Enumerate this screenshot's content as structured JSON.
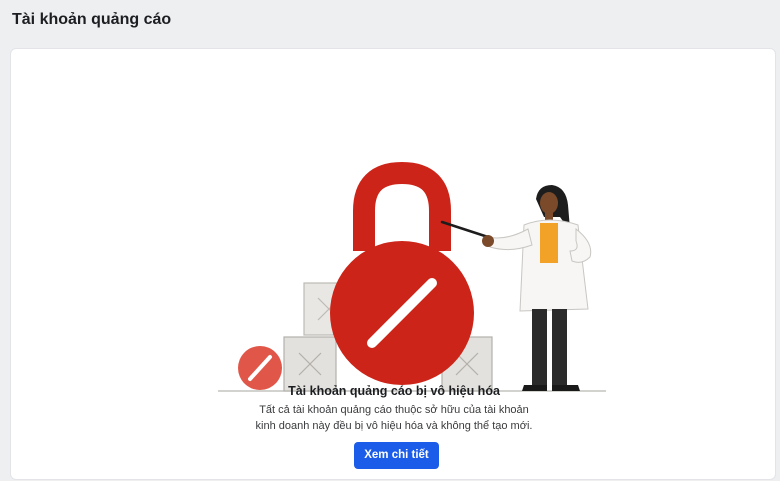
{
  "header": {
    "title": "Tài khoản quảng cáo"
  },
  "notice": {
    "title": "Tài khoản quảng cáo bị vô hiệu hóa",
    "line1": "Tất cả tài khoản quảng cáo thuộc sở hữu của tài khoản",
    "line2": "kinh doanh này đều bị vô hiệu hóa và không thể tạo mới.",
    "button_label": "Xem chi tiết"
  },
  "colors": {
    "accent": "#1b5ce8",
    "lock_red": "#cc2418",
    "badge_red": "#e0574a"
  },
  "icons": [
    "padlock-icon",
    "disabled-badge-icon"
  ]
}
